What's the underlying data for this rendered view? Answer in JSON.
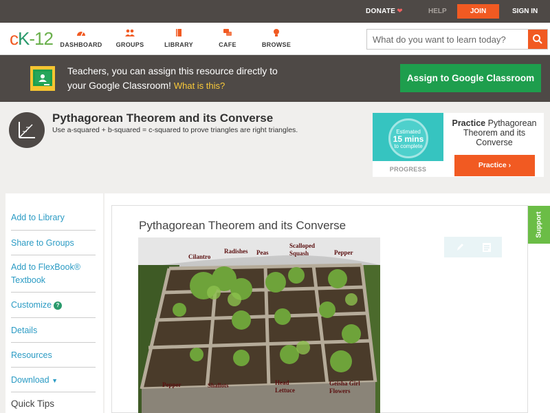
{
  "topbar": {
    "donate": "DONATE",
    "help": "HELP",
    "join": "JOIN",
    "signin": "SIGN IN"
  },
  "logo": {
    "c": "c",
    "k": "K",
    "n": "-12"
  },
  "nav": {
    "items": [
      {
        "label": "DASHBOARD",
        "icon": "gauge-icon"
      },
      {
        "label": "GROUPS",
        "icon": "people-icon"
      },
      {
        "label": "LIBRARY",
        "icon": "book-icon"
      },
      {
        "label": "CAFE",
        "icon": "chat-icon"
      },
      {
        "label": "BROWSE",
        "icon": "lightbulb-icon"
      }
    ],
    "search_placeholder": "What do you want to learn today?"
  },
  "banner": {
    "line1": "Teachers, you can assign this resource directly to",
    "line2": "your Google Classroom!",
    "link": "What is this?",
    "button": "Assign to Google Classroom"
  },
  "header": {
    "title": "Pythagorean Theorem and its Converse",
    "subtitle": "Use a-squared + b-squared = c-squared to prove triangles are right triangles."
  },
  "practice": {
    "estimated": "Estimated",
    "mins": "15 mins",
    "to_complete": "to complete",
    "progress": "PROGRESS",
    "title_bold": "Practice",
    "title_rest": "Pythagorean Theorem and its Converse",
    "button": "Practice"
  },
  "sidebar": {
    "items": [
      {
        "label": "Add to Library"
      },
      {
        "label": "Share to Groups"
      },
      {
        "label": "Add to FlexBook®"
      },
      {
        "label": "Textbook"
      },
      {
        "label": "Customize"
      },
      {
        "label": "Details"
      },
      {
        "label": "Resources"
      },
      {
        "label": "Download"
      }
    ],
    "quick_tips": "Quick Tips"
  },
  "content": {
    "title": "Pythagorean Theorem and its Converse",
    "support": "Support",
    "photo_labels": [
      "Cilantro",
      "Radishes",
      "Peas",
      "Scalloped",
      "Squash",
      "Pepper",
      "Pepper",
      "Shallots",
      "Head",
      "Lettuce",
      "Geisha Girl",
      "Flowers"
    ]
  },
  "colors": {
    "accent_orange": "#f15a22",
    "dark_bar": "#4e4946",
    "green_button": "#1e9e4d",
    "link_blue": "#2b9bc4",
    "support_green": "#6bbd46",
    "teal": "#36c4c0"
  }
}
